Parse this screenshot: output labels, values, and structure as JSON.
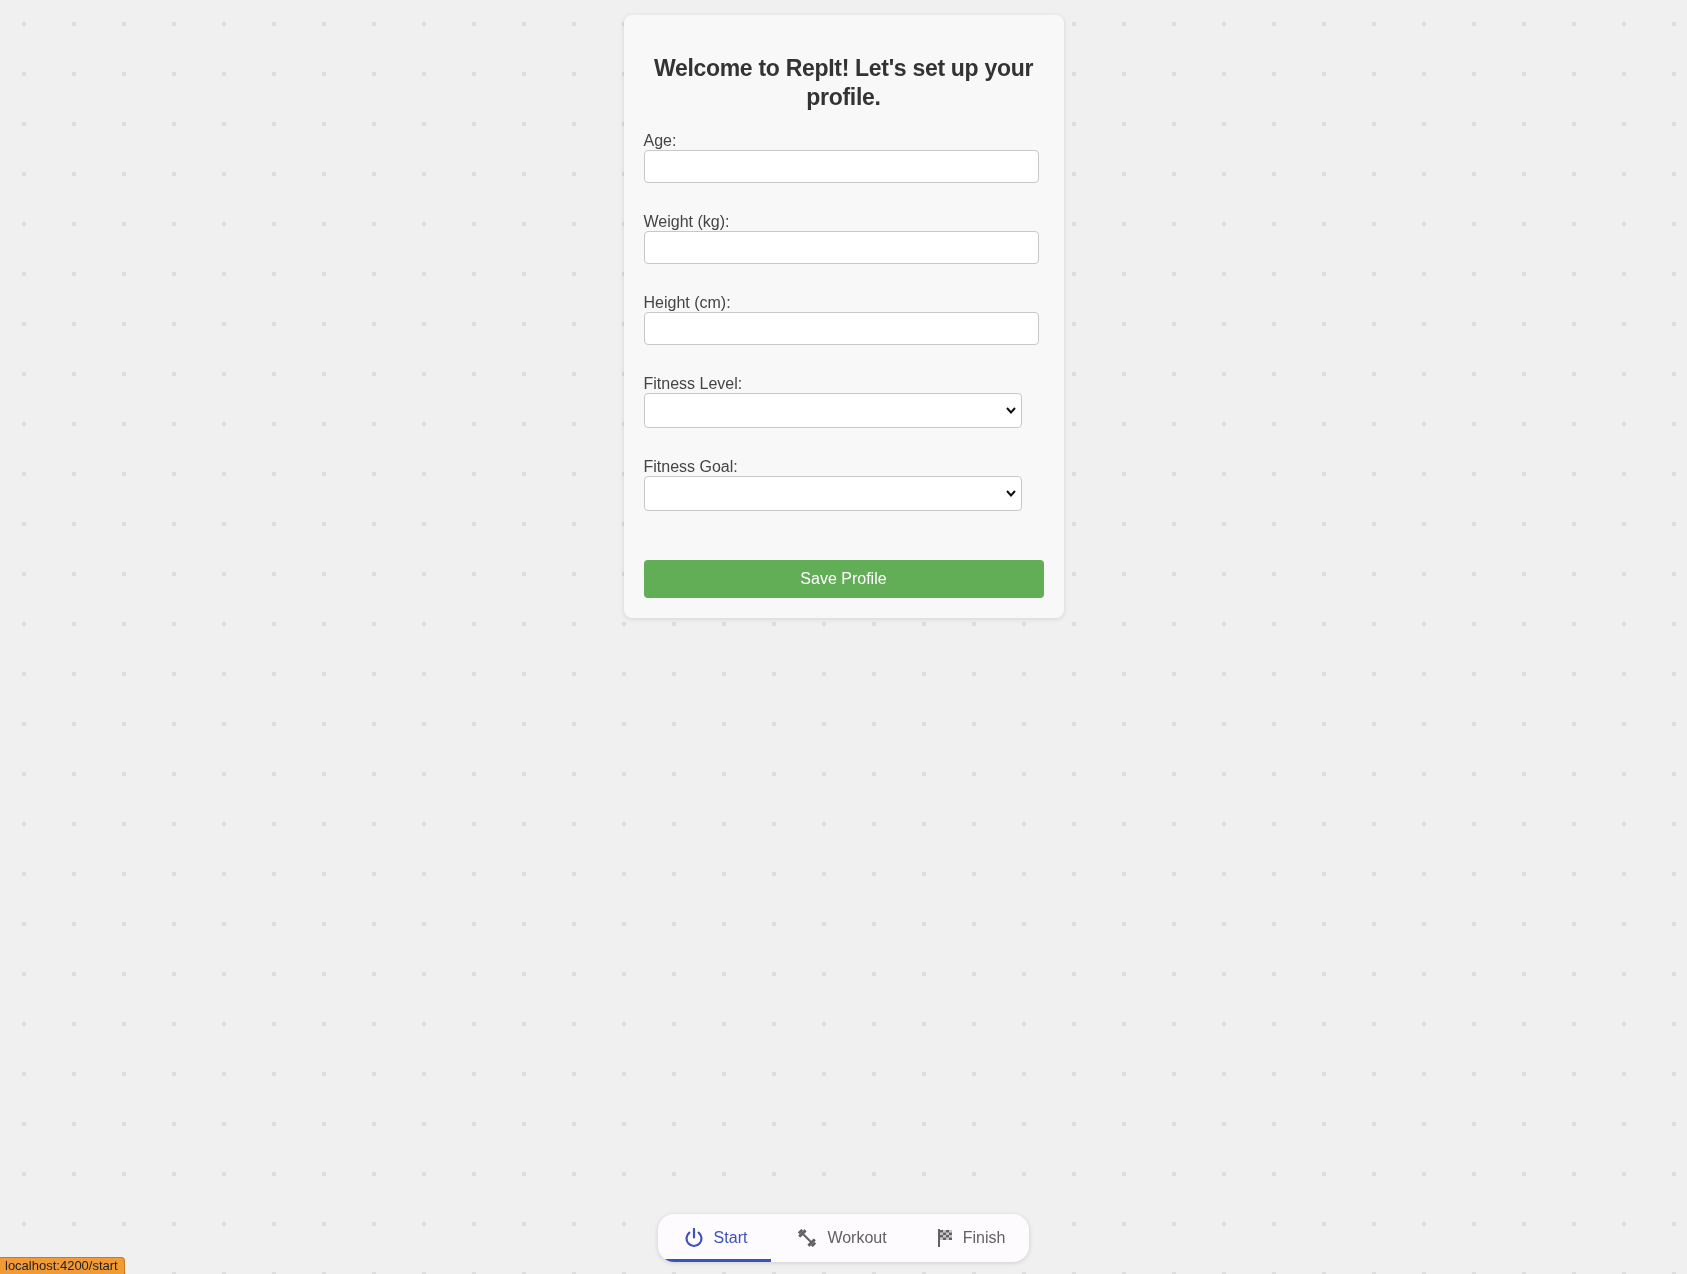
{
  "card": {
    "title": "Welcome to RepIt! Let's set up your profile.",
    "fields": [
      {
        "kind": "input",
        "label": "Age:"
      },
      {
        "kind": "input",
        "label": "Weight (kg):"
      },
      {
        "kind": "input",
        "label": "Height (cm):"
      },
      {
        "kind": "select",
        "label": "Fitness Level:"
      },
      {
        "kind": "select",
        "label": "Fitness Goal:"
      }
    ],
    "button": "Save Profile"
  },
  "bottom_nav": {
    "tabs": [
      {
        "label": "Start",
        "selected": true
      },
      {
        "label": "Workout",
        "selected": false
      },
      {
        "label": "Finish",
        "selected": false
      }
    ]
  },
  "status_bar": {
    "text": "localhost:4200/start"
  }
}
